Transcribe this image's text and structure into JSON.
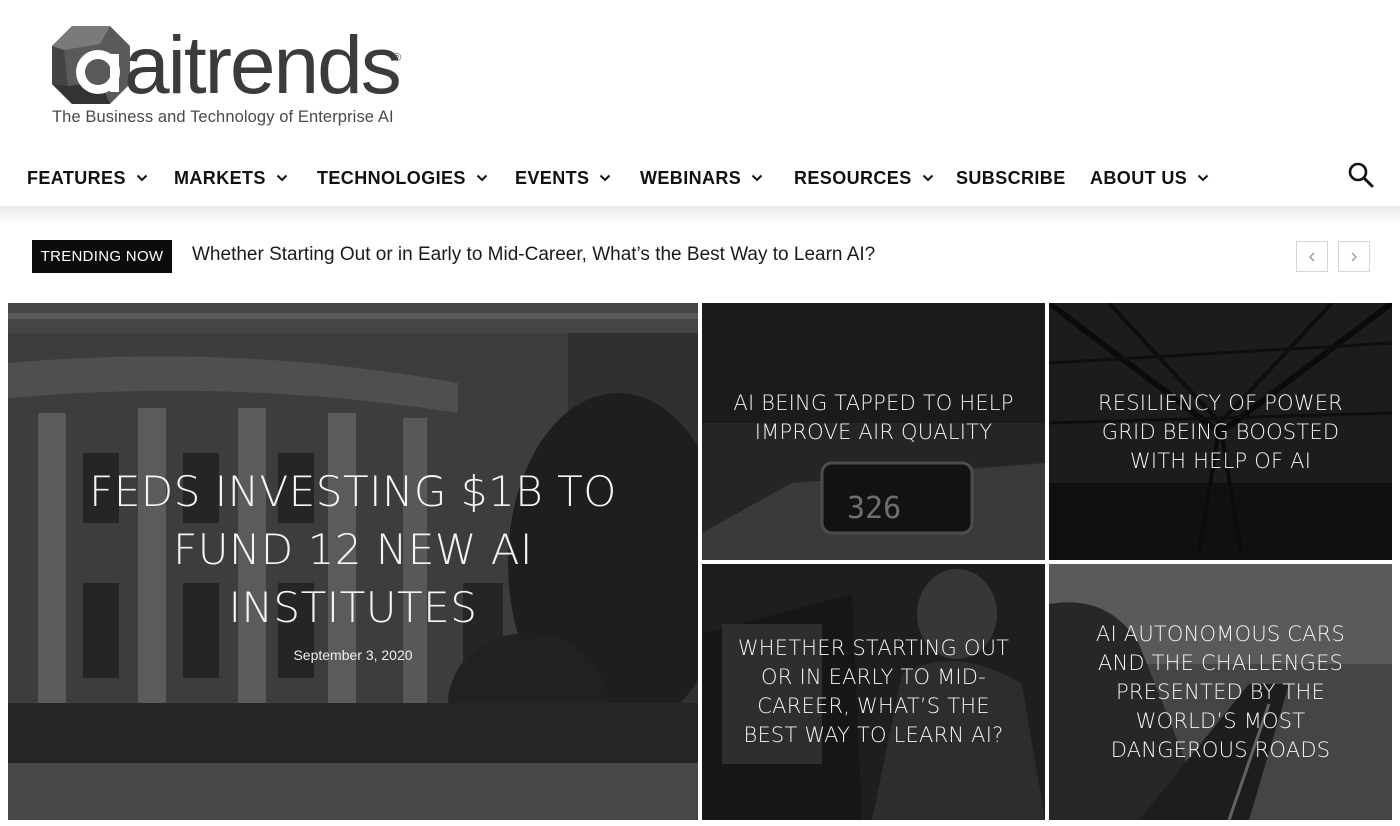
{
  "site": {
    "logo_word": "aitrends",
    "logo_reg": "®",
    "tagline": "The Business and Technology of Enterprise AI"
  },
  "nav": {
    "items": [
      {
        "label": "FEATURES",
        "dropdown": true
      },
      {
        "label": "MARKETS",
        "dropdown": true
      },
      {
        "label": "TECHNOLOGIES",
        "dropdown": true
      },
      {
        "label": "EVENTS",
        "dropdown": true
      },
      {
        "label": "WEBINARS",
        "dropdown": true
      },
      {
        "label": "RESOURCES",
        "dropdown": true
      },
      {
        "label": "SUBSCRIBE",
        "dropdown": false
      },
      {
        "label": "ABOUT US",
        "dropdown": true
      }
    ],
    "search_icon": "search-icon"
  },
  "trending": {
    "badge": "TRENDING NOW",
    "headline": "Whether Starting Out or in Early to Mid-Career, What’s the Best Way to Learn AI?",
    "prev_icon": "chevron-left-icon",
    "next_icon": "chevron-right-icon"
  },
  "featured": {
    "main": {
      "title": "FEDS INVESTING $1B TO FUND 12 NEW AI INSTITUTES",
      "date": "September 3, 2020"
    },
    "tiles": [
      {
        "title": "AI BEING TAPPED TO HELP IMPROVE AIR QUALITY"
      },
      {
        "title": "RESILIENCY OF POWER GRID BEING BOOSTED WITH HELP OF AI"
      },
      {
        "title": "WHETHER STARTING OUT OR IN EARLY TO MID-CAREER, WHAT’S THE BEST WAY TO LEARN AI?"
      },
      {
        "title": "AI AUTONOMOUS CARS AND THE CHALLENGES PRESENTED BY THE WORLD’S MOST DANGEROUS ROADS"
      }
    ]
  },
  "colors": {
    "text": "#111111",
    "badge_bg": "#0c0c0c",
    "tile_overlay": "#000000"
  }
}
